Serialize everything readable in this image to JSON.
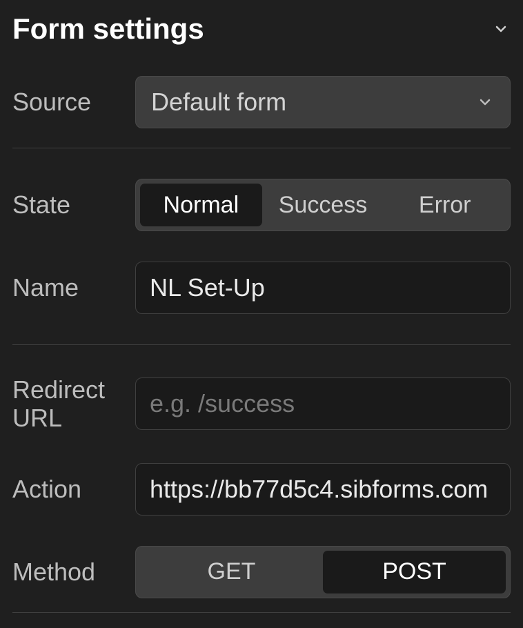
{
  "header": {
    "title": "Form settings"
  },
  "source": {
    "label": "Source",
    "selected": "Default form"
  },
  "state": {
    "label": "State",
    "options": [
      "Normal",
      "Success",
      "Error"
    ],
    "active_index": 0
  },
  "name": {
    "label": "Name",
    "value": "NL Set-Up"
  },
  "redirect": {
    "label": "Redirect URL",
    "value": "",
    "placeholder": "e.g. /success"
  },
  "action": {
    "label": "Action",
    "value": "https://bb77d5c4.sibforms.com"
  },
  "method": {
    "label": "Method",
    "options": [
      "GET",
      "POST"
    ],
    "active_index": 1
  }
}
